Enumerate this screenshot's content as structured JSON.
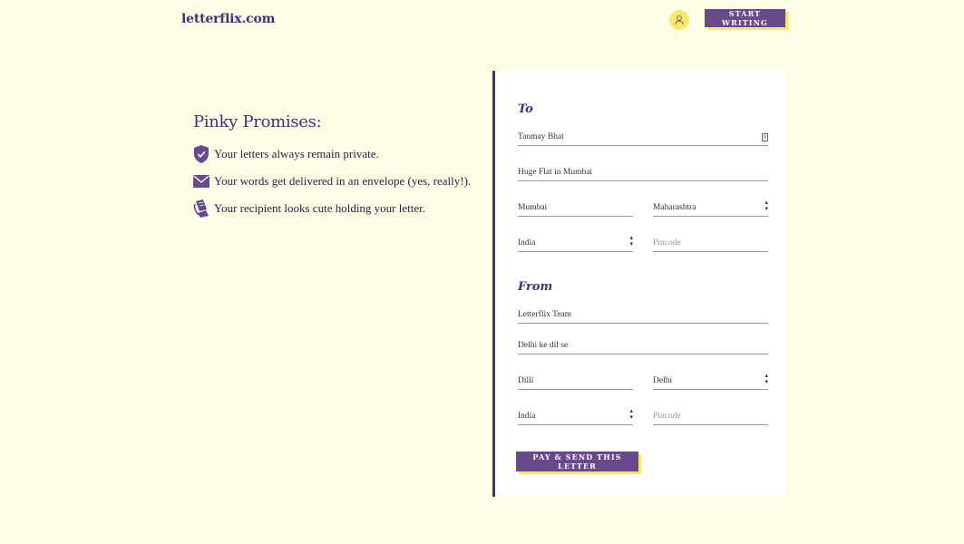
{
  "header": {
    "logo": "letterflix.com",
    "start_button": "START WRITING",
    "avatar_icon": "user-icon"
  },
  "promises": {
    "title": "Pinky Promises:",
    "items": [
      {
        "icon": "shield-check-icon",
        "text": "Your letters always remain private."
      },
      {
        "icon": "envelope-icon",
        "text": "Your words get delivered in an envelope (yes, really!)."
      },
      {
        "icon": "scroll-icon",
        "text": "Your recipient looks cute holding your letter."
      }
    ]
  },
  "form": {
    "to": {
      "title": "To",
      "name": "Tanmay Bhat",
      "address": "Huge Flat in Mumbai",
      "city": "Mumbai",
      "state": "Maharashtra",
      "country": "India",
      "pincode_placeholder": "Pincode"
    },
    "from": {
      "title": "From",
      "name": "Letterflix Team",
      "address": "Delhi ke dil se",
      "city": "Dilli",
      "state": "Delhi",
      "country": "India",
      "pincode_placeholder": "Pincode"
    },
    "submit_button": "PAY & SEND THIS LETTER"
  },
  "colors": {
    "background": "#fffde6",
    "primary": "#684a8c",
    "accent": "#f8e668"
  }
}
